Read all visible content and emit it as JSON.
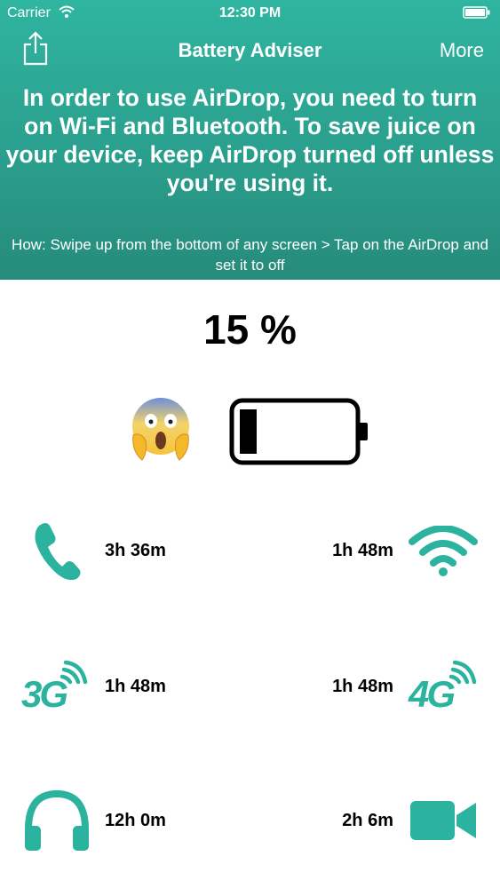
{
  "status_bar": {
    "carrier": "Carrier",
    "time": "12:30 PM"
  },
  "nav": {
    "title": "Battery Adviser",
    "more_label": "More"
  },
  "tip": {
    "main": "In order to use AirDrop, you need to turn on Wi-Fi and Bluetooth. To save juice on your device, keep AirDrop turned off unless you're using it.",
    "how": "How: Swipe up from the bottom of any screen > Tap on the AirDrop and set it to off"
  },
  "battery": {
    "percent_label": "15 %",
    "level": 0.15
  },
  "metrics": {
    "call": "3h 36m",
    "wifi": "1h 48m",
    "three_g": "1h 48m",
    "four_g": "1h 48m",
    "audio": "12h 0m",
    "video": "2h 6m"
  },
  "icon_labels": {
    "three_g": "3G",
    "four_g": "4G"
  },
  "colors": {
    "accent": "#2bb3a0",
    "header_top": "#2fb5a0",
    "header_bottom": "#268b7b"
  }
}
